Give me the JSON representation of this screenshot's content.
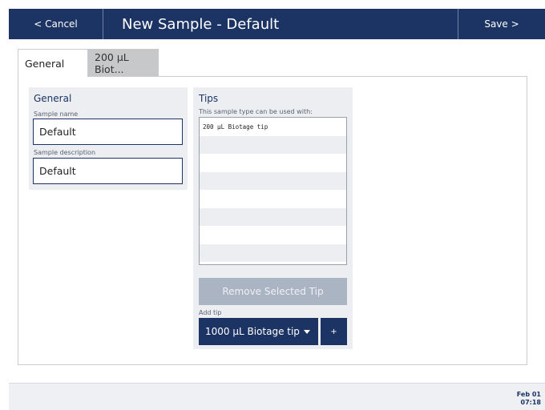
{
  "header": {
    "cancel_label": "< Cancel",
    "title": "New Sample - Default",
    "save_label": "Save >"
  },
  "tabs": [
    {
      "label": "General",
      "active": true
    },
    {
      "label": "200 µL Biot...",
      "active": false
    }
  ],
  "general": {
    "heading": "General",
    "sample_name_label": "Sample name",
    "sample_name_value": "Default",
    "sample_description_label": "Sample description",
    "sample_description_value": "Default"
  },
  "tips": {
    "heading": "Tips",
    "subheading": "This sample type can be used with:",
    "items": [
      "200 µL Biotage tip",
      "",
      "",
      "",
      "",
      "",
      "",
      ""
    ],
    "remove_button_label": "Remove Selected Tip",
    "add_tip_label": "Add tip",
    "add_tip_selected": "1000 µL Biotage tip",
    "add_button_label": "+"
  },
  "status": {
    "date": "Feb 01",
    "time": "07:18"
  },
  "colors": {
    "brand_navy": "#1c3464",
    "disabled_button": "#aab4c3",
    "card_background": "#eceef1"
  }
}
